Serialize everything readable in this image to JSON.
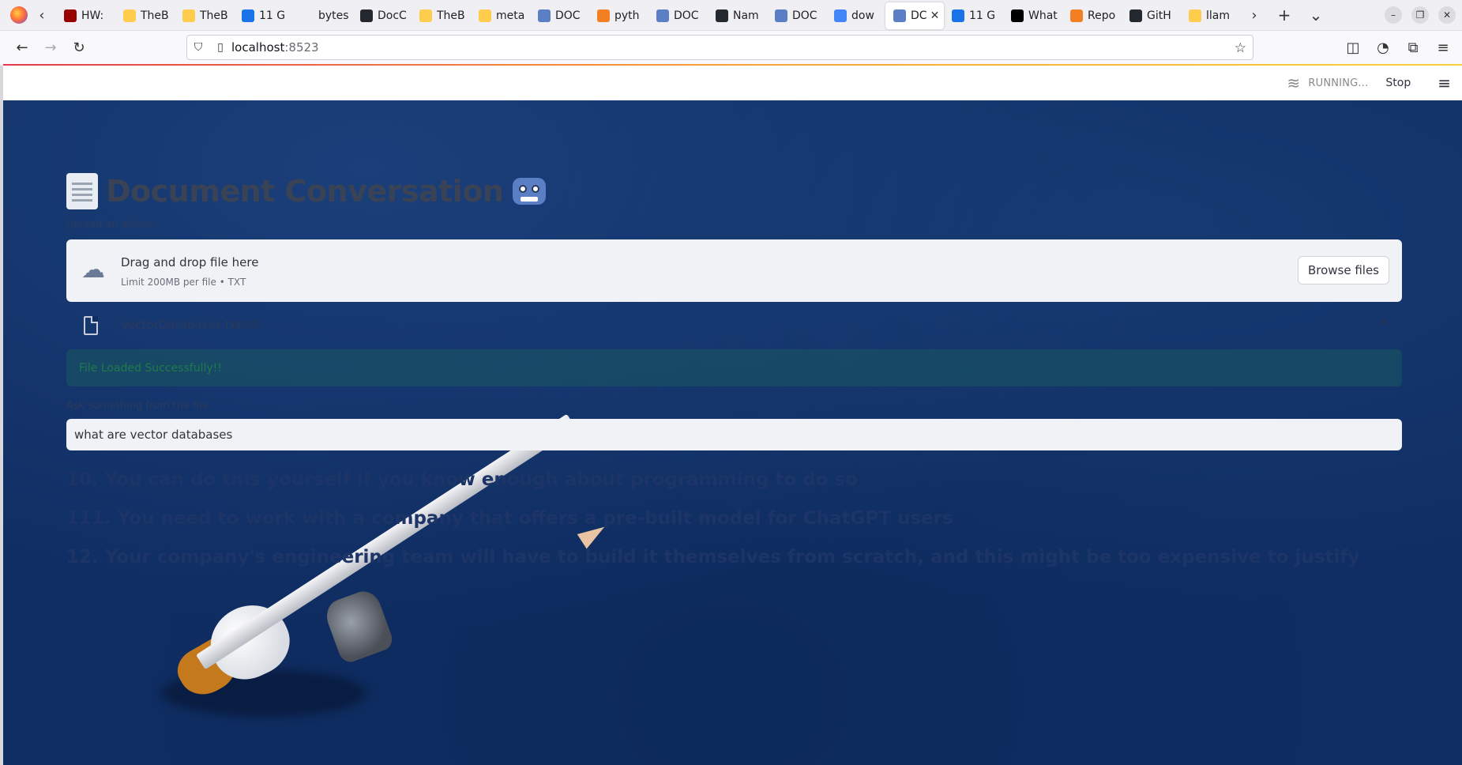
{
  "browser": {
    "tabs": [
      {
        "label": "HW:",
        "favicon": "usc-icon",
        "color": "#990000"
      },
      {
        "label": "TheB",
        "favicon": "huggingface-icon",
        "color": "#ffcc4d"
      },
      {
        "label": "TheB",
        "favicon": "huggingface-icon",
        "color": "#ffcc4d"
      },
      {
        "label": "11 G",
        "favicon": "copilot-icon",
        "color": "#1a73e8"
      },
      {
        "label": "bytes.us",
        "favicon": "none",
        "color": "#f0f0f4"
      },
      {
        "label": "DocC",
        "favicon": "github-icon",
        "color": "#24292f"
      },
      {
        "label": "TheB",
        "favicon": "huggingface-icon",
        "color": "#ffcc4d"
      },
      {
        "label": "meta",
        "favicon": "huggingface-icon",
        "color": "#ffcc4d"
      },
      {
        "label": "DOC",
        "favicon": "robot-icon",
        "color": "#5b7fc4"
      },
      {
        "label": "pyth",
        "favicon": "stackoverflow-icon",
        "color": "#f48024"
      },
      {
        "label": "DOC",
        "favicon": "robot-icon",
        "color": "#5b7fc4"
      },
      {
        "label": "Nam",
        "favicon": "github-icon",
        "color": "#24292f"
      },
      {
        "label": "DOC",
        "favicon": "robot-icon",
        "color": "#5b7fc4"
      },
      {
        "label": "dow",
        "favicon": "google-icon",
        "color": "#4285f4"
      },
      {
        "label": "DC",
        "favicon": "robot-icon",
        "color": "#5b7fc4",
        "active": true
      },
      {
        "label": "11 G",
        "favicon": "copilot-icon",
        "color": "#1a73e8"
      },
      {
        "label": "What",
        "favicon": "medium-icon",
        "color": "#000000"
      },
      {
        "label": "Repo",
        "favicon": "stackoverflow-icon",
        "color": "#f48024"
      },
      {
        "label": "GitH",
        "favicon": "github-icon",
        "color": "#24292f"
      },
      {
        "label": "llam",
        "favicon": "huggingface-icon",
        "color": "#ffcc4d"
      }
    ],
    "url_host": "localhost",
    "url_port": ":8523"
  },
  "streamlit": {
    "status": "RUNNING...",
    "stop_label": "Stop"
  },
  "app": {
    "title": "Document Conversation",
    "upload_label": "Upload an article",
    "dropzone_title": "Drag and drop file here",
    "dropzone_limit": "Limit 200MB per file • TXT",
    "browse_label": "Browse files",
    "file_name": "VectorDatabases.txt",
    "file_size": "7.5KB",
    "success_message": "File Loaded Successfully!!",
    "query_label": "Ask something from the file",
    "query_value": "what are vector databases",
    "answers": [
      "10. You can do this yourself if you know enough about programming to do so",
      "111. You need to work with a company that offers a pre-built model for ChatGPT users",
      "12. Your company's engineering team will have to build it themselves from scratch, and this might be too expensive to justify"
    ]
  },
  "colors": {
    "background": "#0f2d62",
    "success_text": "#1f7a4a",
    "answer_text": "#1c3466"
  }
}
